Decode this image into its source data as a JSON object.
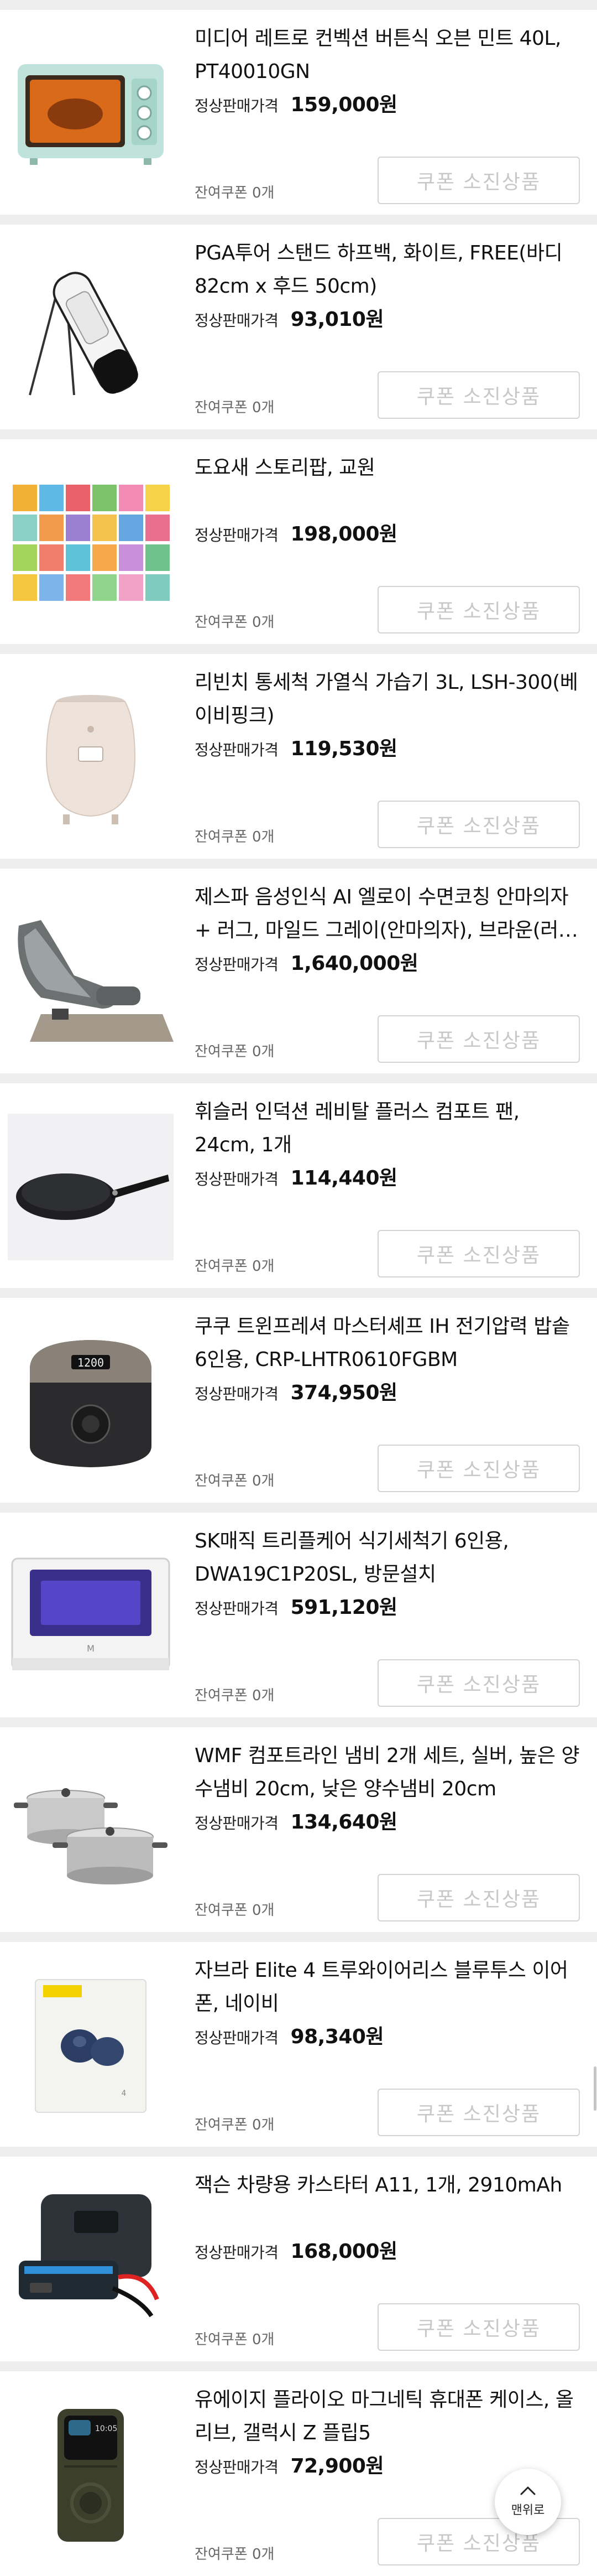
{
  "labels": {
    "price_label": "정상판매가격",
    "coupon_left": "잔여쿠폰 0개",
    "coupon_button": "쿠폰 소진상품",
    "top_button": "맨위로"
  },
  "products": [
    {
      "title": "미디어 레트로 컨벡션 버튼식 오븐 민트 40L, PT40010GN",
      "price": "159,000원",
      "icon": "oven-icon"
    },
    {
      "title": "PGA투어 스탠드 하프백, 화이트, FREE(바디 82cm x 후드 50cm)",
      "price": "93,010원",
      "icon": "golf-bag-icon"
    },
    {
      "title": "도요새 스토리팝, 교원",
      "price": "198,000원",
      "icon": "books-icon"
    },
    {
      "title": "리빈치 통세척 가열식 가습기 3L, LSH-300(베이비핑크)",
      "price": "119,530원",
      "icon": "humidifier-icon"
    },
    {
      "title": "제스파 음성인식 AI 엘로이 수면코칭 안마의자 + 러그, 마일드 그레이(안마의자), 브라운(러그)",
      "price": "1,640,000원",
      "icon": "massage-chair-icon"
    },
    {
      "title": "휘슬러 인덕션 레비탈 플러스 컴포트 팬, 24cm, 1개",
      "price": "114,440원",
      "icon": "frying-pan-icon"
    },
    {
      "title": "쿠쿠 트윈프레셔 마스터셰프 IH 전기압력 밥솥 6인용, CRP-LHTR0610FGBM",
      "price": "374,950원",
      "icon": "rice-cooker-icon"
    },
    {
      "title": "SK매직 트리플케어 식기세척기 6인용, DWA19C1P20SL, 방문설치",
      "price": "591,120원",
      "icon": "dishwasher-icon"
    },
    {
      "title": "WMF 컴포트라인 냄비 2개 세트, 실버, 높은 양수냄비 20cm, 낮은 양수냄비 20cm",
      "price": "134,640원",
      "icon": "pot-set-icon"
    },
    {
      "title": "자브라 Elite 4 트루와이어리스 블루투스 이어폰, 네이비",
      "price": "98,340원",
      "icon": "earbuds-icon"
    },
    {
      "title": "잭슨 차량용 카스타터 A11, 1개, 2910mAh",
      "price": "168,000원",
      "icon": "jump-starter-icon"
    },
    {
      "title": "유에이지 플라이오 마그네틱 휴대폰 케이스, 올리브, 갤럭시 Z 플립5",
      "price": "72,900원",
      "icon": "phone-case-icon"
    }
  ]
}
